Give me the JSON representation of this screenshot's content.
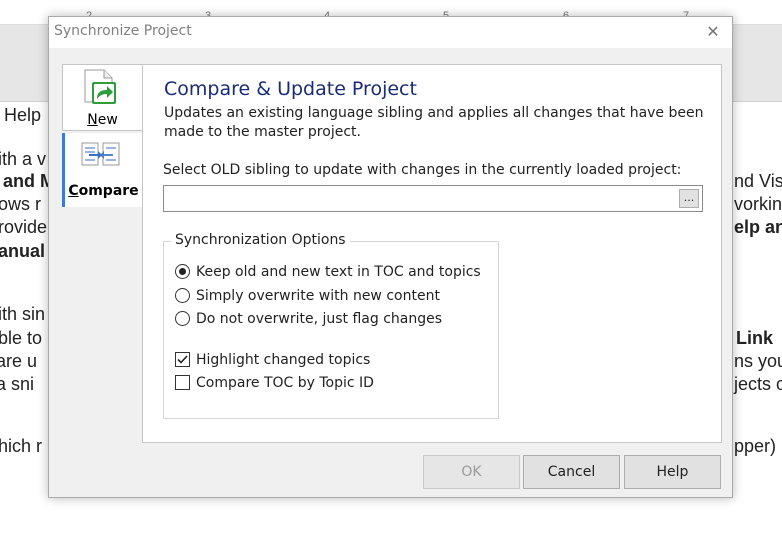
{
  "background": {
    "ruler_ticks": [
      "2",
      "3",
      "4",
      "5",
      "6",
      "7"
    ],
    "lines": [
      {
        "text": "Help",
        "bold": false
      },
      {
        "text": "ith a v",
        "bold": false
      },
      {
        "text": "and M",
        "bold": true
      },
      {
        "text": "ows r",
        "bold": false
      },
      {
        "text": "rovide",
        "bold": false
      },
      {
        "text": "anual",
        "bold": true
      },
      {
        "text": "ith sin",
        "bold": false
      },
      {
        "text": "ble to",
        "bold": false
      },
      {
        "text": "are u",
        "bold": false
      },
      {
        "text": "a sni",
        "bold": false
      },
      {
        "text": "hich r",
        "bold": false
      },
      {
        "text": "nd Vis",
        "bold": false
      },
      {
        "text": "vorkin",
        "bold": false
      },
      {
        "text": "elp an",
        "bold": true
      },
      {
        "text": "Link",
        "bold": true
      },
      {
        "text": "ns you",
        "bold": false
      },
      {
        "text": "jects o",
        "bold": false
      },
      {
        "text": "pper)",
        "bold": false
      }
    ]
  },
  "dialog": {
    "title": "Synchronize Project",
    "close_icon": "close-icon",
    "tabs": [
      {
        "label": "New",
        "accesskey": "N",
        "rest": "ew",
        "icon": "new-document-arrow-icon",
        "selected": false
      },
      {
        "label": "Compare",
        "accesskey": "C",
        "rest": "ompare",
        "icon": "compare-arrows-icon",
        "selected": true
      }
    ],
    "panel": {
      "heading": "Compare & Update Project",
      "description": "Updates an existing language sibling and applies all changes that have been made to the master project.",
      "select_label": "Select OLD sibling to update with changes in the currently loaded project:",
      "file_value": "",
      "browse_label": "...",
      "options_group": {
        "title": "Synchronization Options",
        "radios": [
          {
            "label": "Keep old and new text in TOC and topics",
            "checked": true
          },
          {
            "label": "Simply overwrite with new content",
            "checked": false
          },
          {
            "label": "Do not overwrite, just flag changes",
            "checked": false
          }
        ],
        "checkboxes": [
          {
            "label": "Highlight changed topics",
            "checked": true
          },
          {
            "label": "Compare TOC by Topic ID",
            "checked": false
          }
        ]
      }
    },
    "buttons": {
      "ok": "OK",
      "cancel": "Cancel",
      "help": "Help"
    },
    "colors": {
      "heading": "#1a2c78",
      "tab_accent": "#3c7bd4",
      "icon_green": "#2e9e3a",
      "icon_blue": "#3a6fc4"
    }
  }
}
